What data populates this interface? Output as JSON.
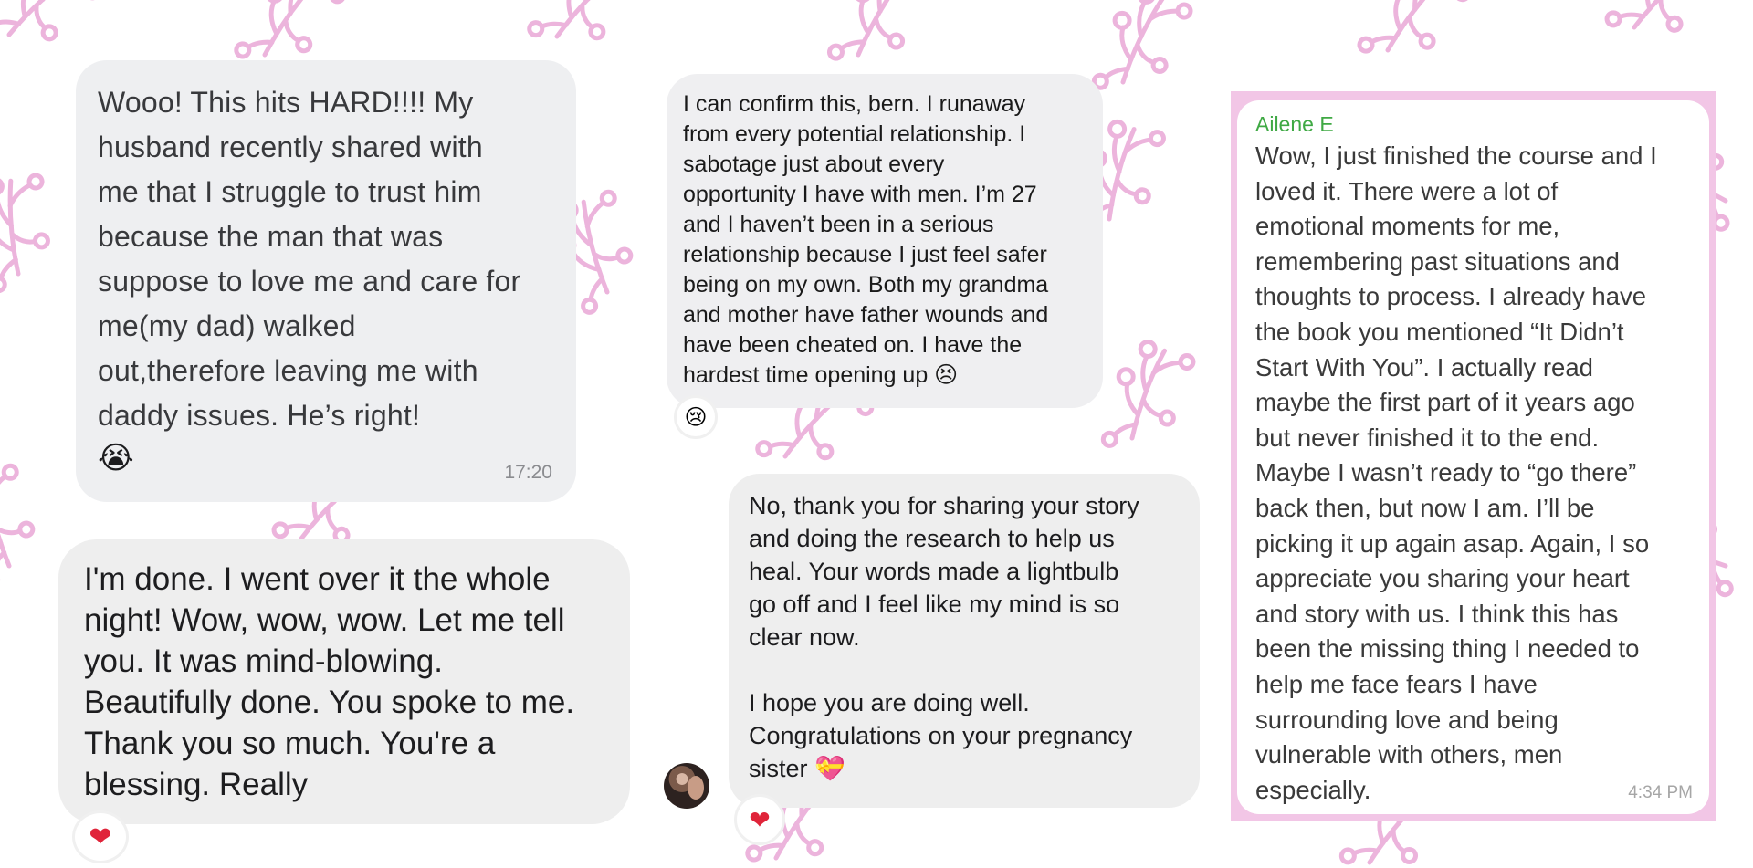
{
  "messages": [
    {
      "text": "Wooo! This hits HARD!!!! My\nhusband recently shared with\nme that I struggle to trust him\nbecause the man that was\nsuppose to love me and care for\nme(my dad) walked\nout,therefore leaving me with\ndaddy issues. He’s right!",
      "emoji": "😭",
      "time": "17:20"
    },
    {
      "text": "I'm done. I went over it the whole\nnight! Wow, wow, wow. Let me tell\nyou. It was mind-blowing.\nBeautifully done. You spoke to me.\nThank you so much. You're a\nblessing. Really",
      "reaction": "❤"
    },
    {
      "text": "I can confirm this, bern. I runaway\nfrom every potential relationship. I\nsabotage just about every\nopportunity I have with men. I’m 27\nand I haven’t been in a serious\nrelationship because I just feel safer\nbeing on my own. Both my grandma\nand mother have father wounds and\nhave been cheated on. I have the\nhardest time opening up 😣",
      "reaction": "😢"
    },
    {
      "text": "No, thank you for sharing your story\nand doing the research to help us\nheal. Your words made a lightbulb\ngo off and I feel like my mind is so\nclear now.\n\nI hope you are doing well.\nCongratulations on your pregnancy\nsister 💝",
      "reaction": "❤"
    },
    {
      "sender": "Ailene E",
      "text": "Wow, I just finished the course and I\nloved it. There were a lot of\nemotional moments for me,\nremembering past situations and\nthoughts to process. I already have\nthe book you mentioned “It Didn’t\nStart With You”. I actually read\nmaybe the first part of it years ago\nbut never finished it to the end.\nMaybe I wasn’t ready to “go there”\nback then, but now I am. I’ll be\npicking it up again asap. Again, I so\nappreciate you sharing your heart\nand story with us. I think this has\nbeen the missing thing I needed to\nhelp me face fears I have\nsurrounding love and being\nvulnerable with others, men\nespecially.",
      "time": "4:34 PM"
    }
  ],
  "colors": {
    "pattern": "#ecb4dc",
    "bubble_gray": "#eeeff1",
    "sender_green": "#3fa944",
    "reaction_red": "#e0243a"
  },
  "icons": {
    "heart": "heart-icon",
    "crying_face": "crying-face-icon",
    "avatar": "avatar"
  }
}
